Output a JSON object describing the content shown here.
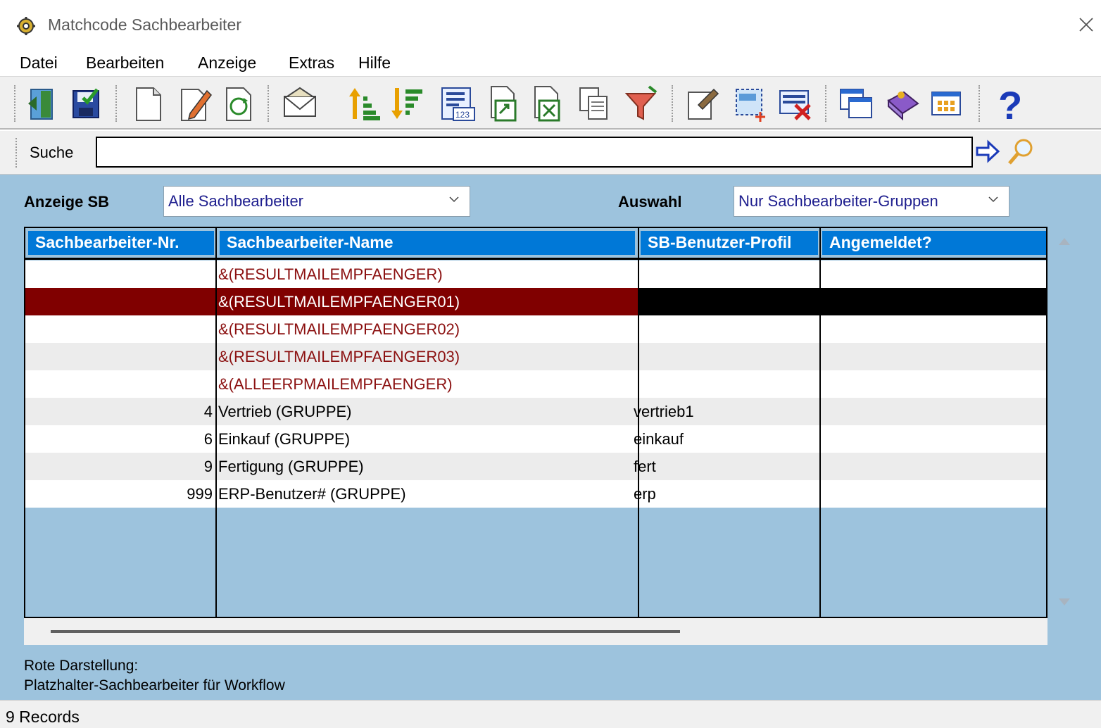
{
  "window": {
    "title": "Matchcode Sachbearbeiter"
  },
  "menu": [
    "Datei",
    "Bearbeiten",
    "Anzeige",
    "Extras",
    "Hilfe"
  ],
  "toolbar": {
    "icons": [
      "exit-icon",
      "save-icon",
      "new-document-icon",
      "edit-icon",
      "refresh-icon",
      "mail-icon",
      "sort-ascending-icon",
      "sort-descending-icon",
      "number-format-icon",
      "export-icon",
      "excel-export-icon",
      "copy-icon",
      "filter-icon",
      "properties-icon",
      "add-column-icon",
      "delete-icon",
      "windows-icon",
      "book-icon",
      "grid-view-icon",
      "help-icon"
    ]
  },
  "search": {
    "label": "Suche",
    "value": ""
  },
  "filters": {
    "anzeige_label": "Anzeige SB",
    "anzeige_value": "Alle Sachbearbeiter",
    "auswahl_label": "Auswahl",
    "auswahl_value": "Nur Sachbearbeiter-Gruppen"
  },
  "table": {
    "columns": [
      "Sachbearbeiter-Nr.",
      "Sachbearbeiter-Name",
      "SB-Benutzer-Profil",
      "Angemeldet?"
    ],
    "rows": [
      {
        "nr": "",
        "name": "&(RESULTMAILEMPFAENGER)",
        "profil": "",
        "angemeldet": "",
        "placeholder": true
      },
      {
        "nr": "",
        "name": "&(RESULTMAILEMPFAENGER01)",
        "profil": "",
        "angemeldet": "",
        "placeholder": true,
        "selected": true
      },
      {
        "nr": "",
        "name": "&(RESULTMAILEMPFAENGER02)",
        "profil": "",
        "angemeldet": "",
        "placeholder": true
      },
      {
        "nr": "",
        "name": "&(RESULTMAILEMPFAENGER03)",
        "profil": "",
        "angemeldet": "",
        "placeholder": true
      },
      {
        "nr": "",
        "name": "&(ALLEERPMAILEMPFAENGER)",
        "profil": "",
        "angemeldet": "",
        "placeholder": true
      },
      {
        "nr": "4",
        "name": "Vertrieb (GRUPPE)",
        "profil": "vertrieb1",
        "angemeldet": ""
      },
      {
        "nr": "6",
        "name": "Einkauf (GRUPPE)",
        "profil": "einkauf",
        "angemeldet": ""
      },
      {
        "nr": "9",
        "name": "Fertigung (GRUPPE)",
        "profil": "fert",
        "angemeldet": ""
      },
      {
        "nr": "999",
        "name": "ERP-Benutzer# (GRUPPE)",
        "profil": "erp",
        "angemeldet": ""
      }
    ]
  },
  "note": {
    "line1": "Rote Darstellung:",
    "line2": "Platzhalter-Sachbearbeiter für Workflow"
  },
  "status": {
    "records": "9 Records"
  },
  "colors": {
    "header": "#0078d7",
    "background": "#9dc3dd",
    "selected_row": "#800000",
    "placeholder_text": "#8b1010"
  }
}
